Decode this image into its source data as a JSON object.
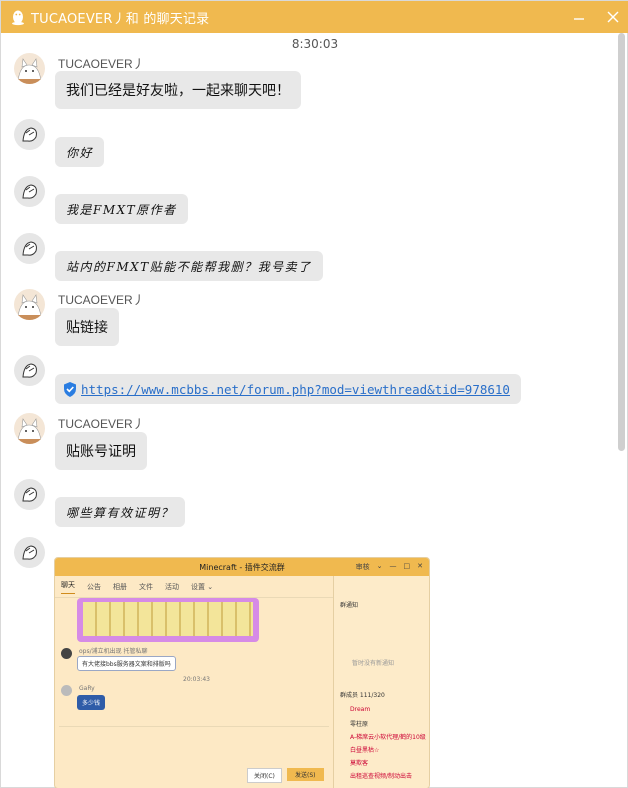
{
  "window": {
    "title": "TUCAOEVER丿和    的聊天记录",
    "minimize_label": "—",
    "close_label": "✕"
  },
  "chat": {
    "timestamp": "8:30:03",
    "messages": [
      {
        "sender": "TUCAOEVER丿",
        "text": "我们已经是好友啦，一起来聊天吧！",
        "from": "user"
      },
      {
        "sender": "",
        "text": "你好",
        "from": "other"
      },
      {
        "sender": "",
        "text": "我是FMXT原作者",
        "from": "other"
      },
      {
        "sender": "",
        "text": "站内的FMXT贴能不能帮我删？我号卖了",
        "from": "other"
      },
      {
        "sender": "TUCAOEVER丿",
        "text": "贴链接",
        "from": "user"
      },
      {
        "sender": "",
        "text": "https://www.mcbbs.net/forum.php?mod=viewthread&tid=978610",
        "from": "other",
        "type": "link"
      },
      {
        "sender": "TUCAOEVER丿",
        "text": "贴账号证明",
        "from": "user"
      },
      {
        "sender": "",
        "text": "哪些算有效证明？",
        "from": "other"
      }
    ]
  },
  "screenshot": {
    "title": "Minecraft - 插件交流群",
    "header_right": [
      "审核",
      "⌄",
      "—",
      "□",
      "✕"
    ],
    "tabs": [
      "聊天",
      "公告",
      "相册",
      "文件",
      "活动",
      "设置 ⌄"
    ],
    "messages": [
      {
        "sender": "ops/浦立机出现 托管私聊",
        "text": "有大佬接bbs服务器文案和排版吗"
      },
      {
        "sender": "GaRy",
        "text": "多少钱"
      }
    ],
    "time": "20:03:43",
    "group_notice_label": "群通知",
    "no_notice_text": "暂时没有新通知",
    "members_label": "群成员 111/320",
    "members": [
      "Dream",
      "零柱原",
      "A-梯席云小软代理/鹤的10级",
      "白昼黑枯☆",
      "莫欺客",
      "出租巡查视频/制动出击"
    ],
    "close_label": "关闭(C)",
    "send_label": "发送(S)"
  }
}
